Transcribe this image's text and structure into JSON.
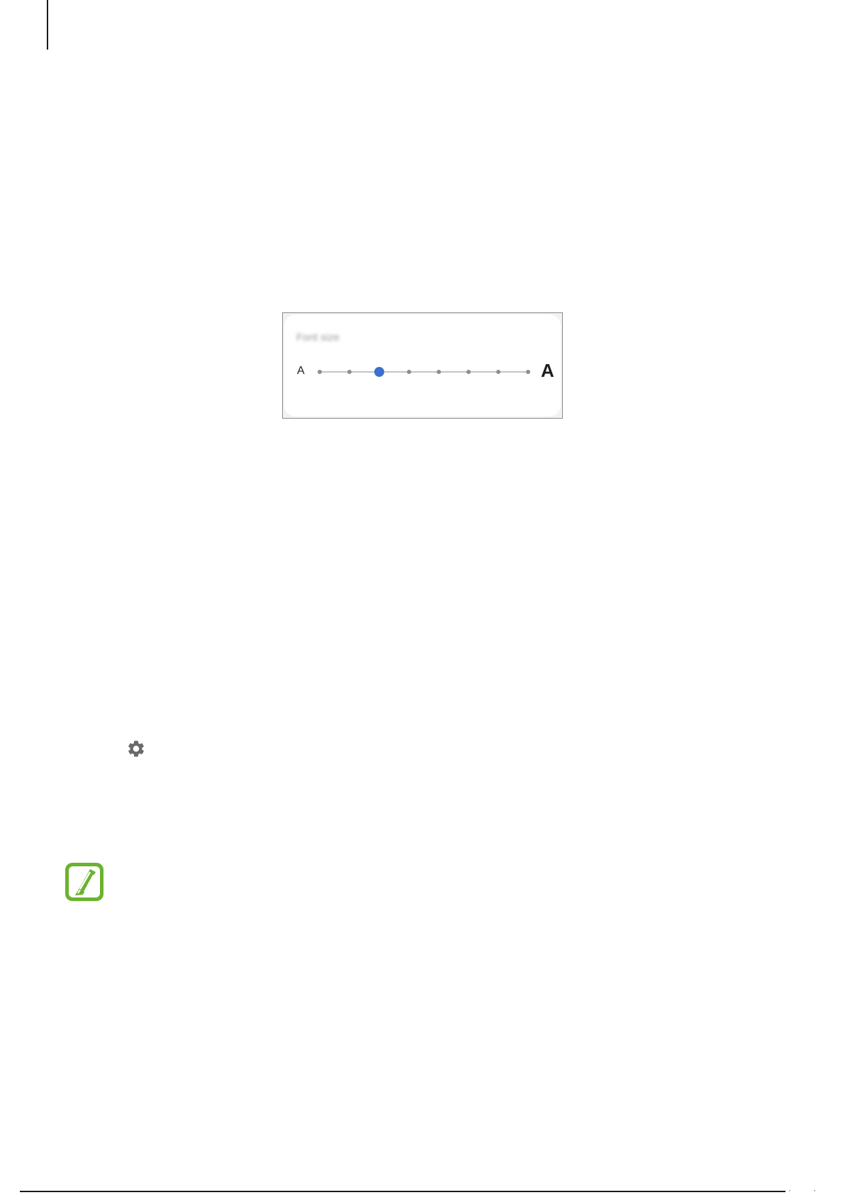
{
  "font_size_panel": {
    "title": "Font size",
    "small_label": "A",
    "large_label": "A",
    "slider": {
      "steps": 8,
      "selected_step": 3,
      "accent_color": "#3d6fcf",
      "step_color": "#8e8e8e",
      "track_color": "#c4c4c4"
    }
  },
  "icons": {
    "settings": "gear-icon",
    "note": "note-pencil-icon",
    "note_color": "#6bb22e"
  },
  "footer": {
    "page_marks": "· ·"
  }
}
